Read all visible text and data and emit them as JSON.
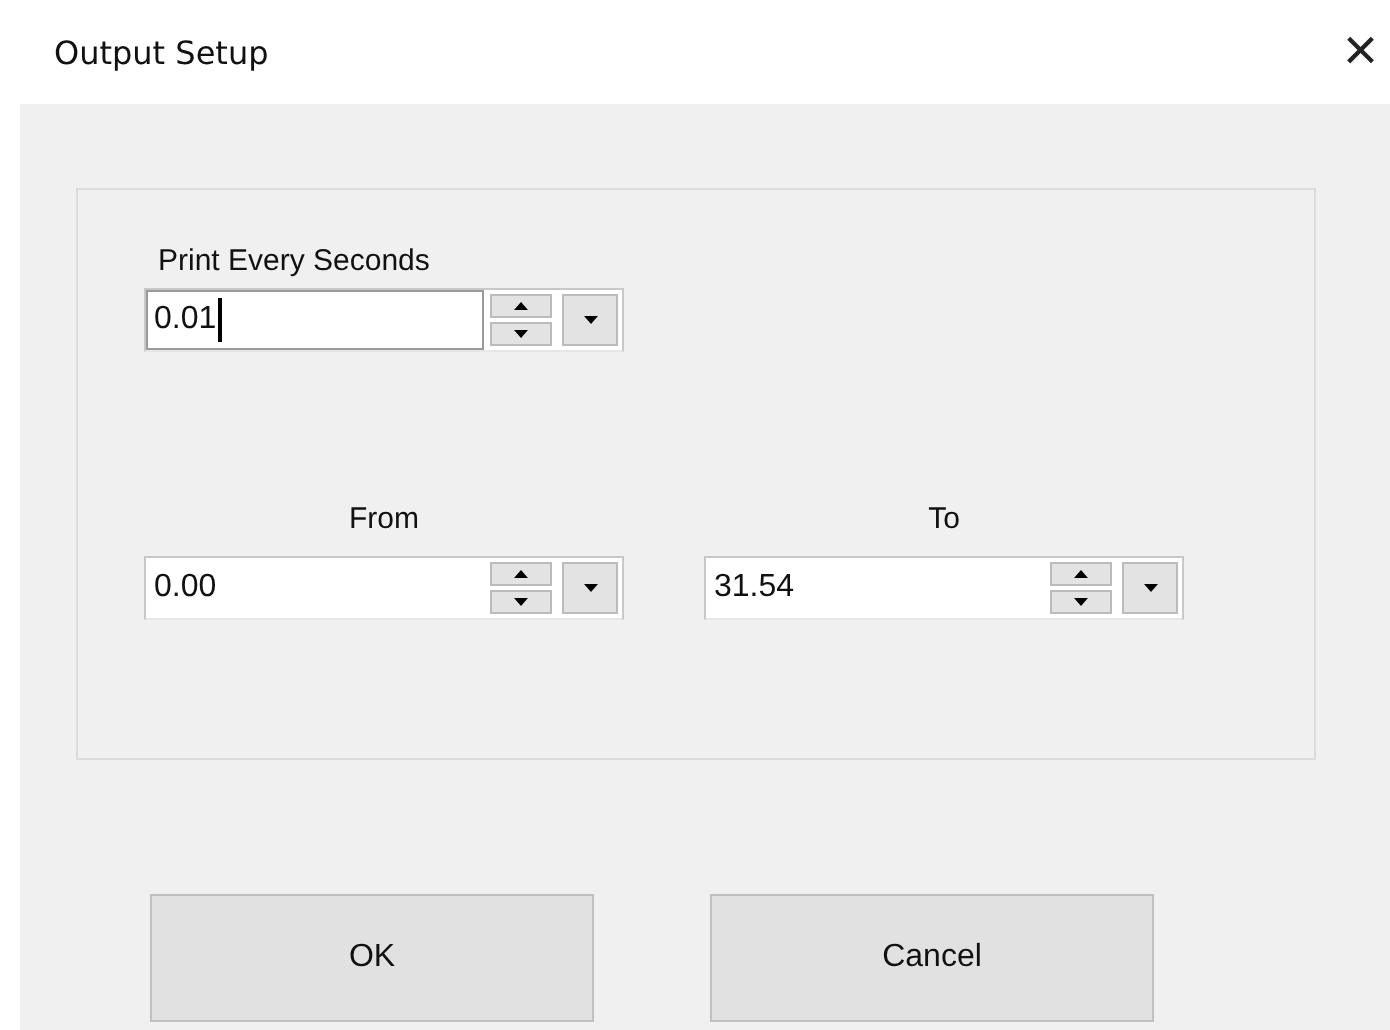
{
  "window": {
    "title": "Output Setup",
    "close": "×"
  },
  "fields": [
    {
      "label": "Print Every Seconds",
      "value": "0.01",
      "focused": true
    },
    {
      "label": "From",
      "value": "0.00",
      "focused": false
    },
    {
      "label": "To",
      "value": "31.54",
      "focused": false
    }
  ],
  "buttons": [
    "OK",
    "Cancel"
  ]
}
